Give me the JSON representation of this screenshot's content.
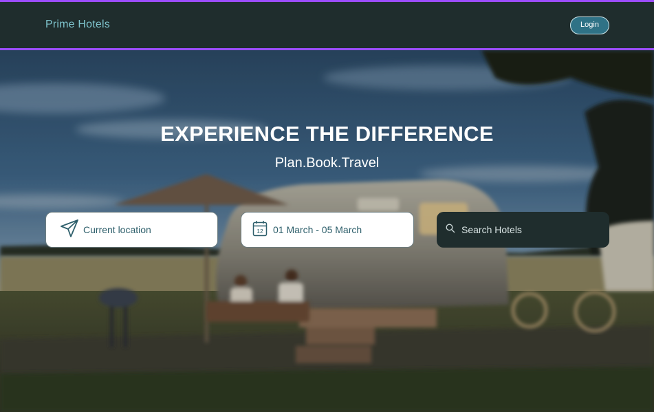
{
  "nav": {
    "brand": "Prime Hotels",
    "login_label": "Login"
  },
  "hero": {
    "headline": "EXPERIENCE THE DIFFERENCE",
    "tagline": "Plan.Book.Travel"
  },
  "search_bar": {
    "location_label": "Current location",
    "location_icon": "paper-plane-icon",
    "dates_label": "01 March - 05 March",
    "date_icon": "calendar-icon",
    "calendar_day": "12",
    "search_label": "Search Hotels",
    "search_icon": "search-icon"
  },
  "colors": {
    "nav_bg": "#1f2d2d",
    "nav_border": "#9b4dff",
    "brand_text": "#7ec3cc",
    "login_bg": "#2f7286",
    "field_text": "#2e5f6b"
  }
}
